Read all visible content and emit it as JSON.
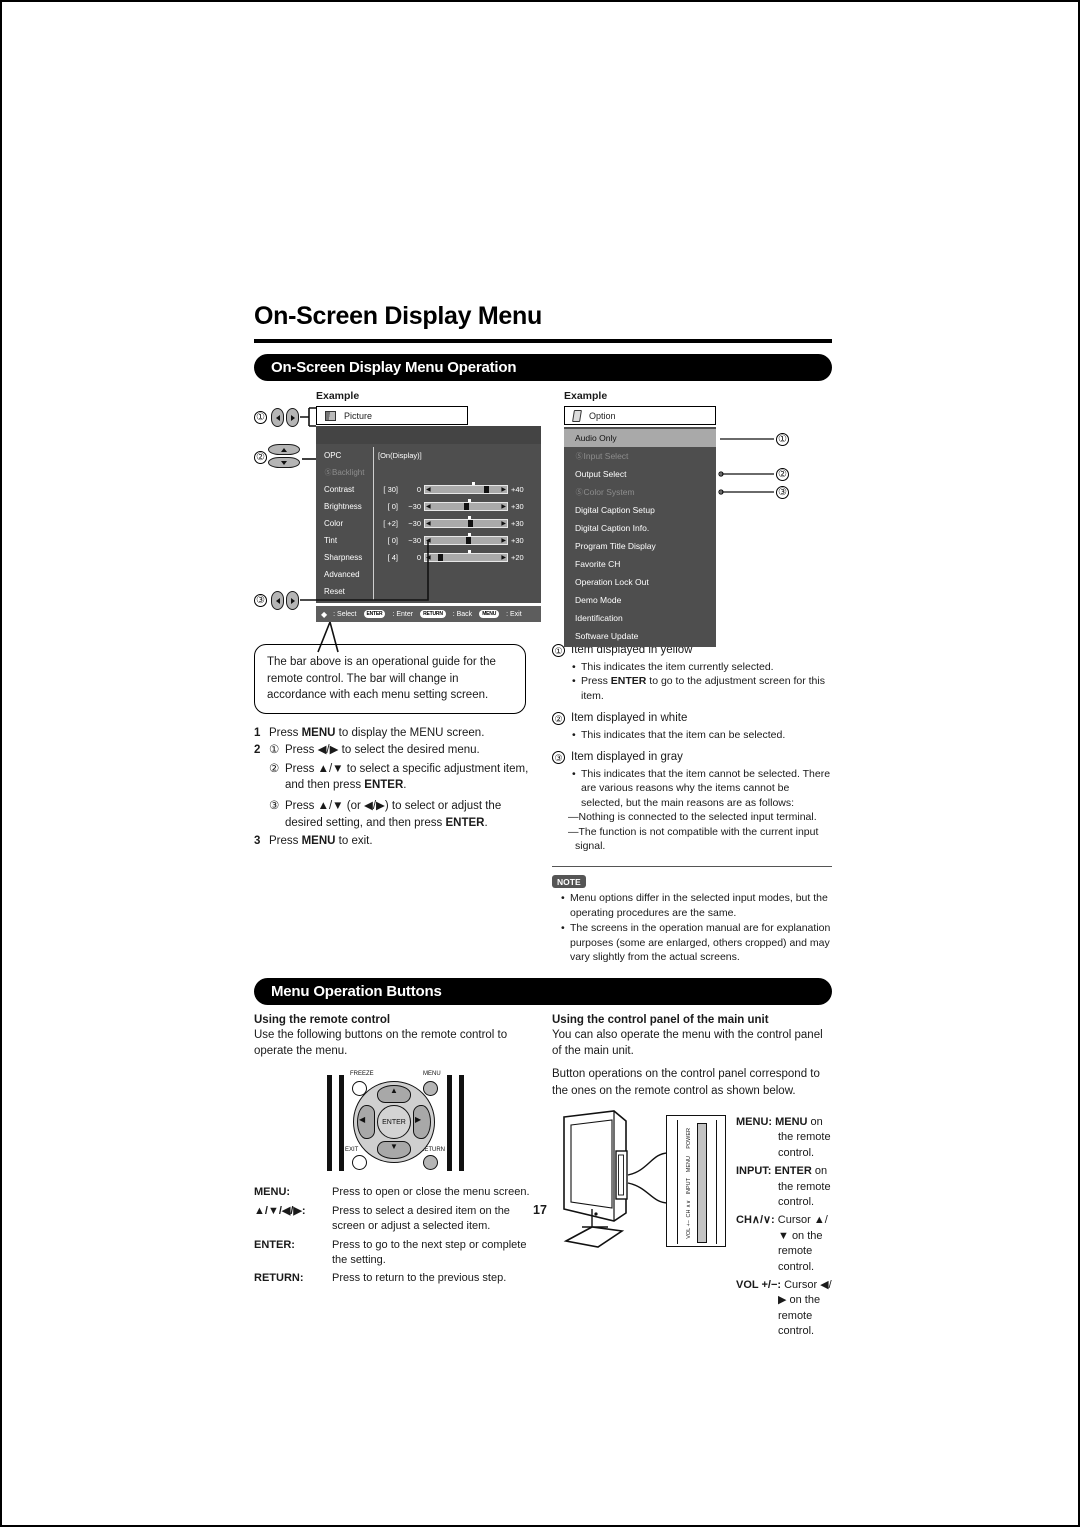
{
  "page": {
    "title": "On-Screen Display Menu",
    "number": "17"
  },
  "section1": {
    "banner": "On-Screen Display Menu Operation",
    "example_label_left": "Example",
    "example_label_right": "Example"
  },
  "picture_menu": {
    "tab_label": "Picture",
    "tab_icon": "picture-icon",
    "items": [
      {
        "label": "OPC",
        "state": "normal"
      },
      {
        "label": "Backlight",
        "state": "dim",
        "prefix": "ban-icon"
      },
      {
        "label": "Contrast",
        "state": "normal"
      },
      {
        "label": "Brightness",
        "state": "normal"
      },
      {
        "label": "Color",
        "state": "normal"
      },
      {
        "label": "Tint",
        "state": "normal"
      },
      {
        "label": "Sharpness",
        "state": "normal"
      },
      {
        "label": "Advanced",
        "state": "normal"
      },
      {
        "label": "Reset",
        "state": "normal"
      }
    ],
    "opc_value": "[On(Display)]",
    "sliders": [
      {
        "name": "Contrast",
        "value": "[ 30]",
        "min": "0",
        "max": "+40",
        "pos": 72,
        "tick": 57
      },
      {
        "name": "Brightness",
        "value": "[  0]",
        "min": "−30",
        "max": "+30",
        "pos": 48,
        "tick": 52
      },
      {
        "name": "Color",
        "value": "[ +2]",
        "min": "−30",
        "max": "+30",
        "pos": 53,
        "tick": 52
      },
      {
        "name": "Tint",
        "value": "[  0]",
        "min": "−30",
        "max": "+30",
        "pos": 50,
        "tick": 52
      },
      {
        "name": "Sharpness",
        "value": "[  4]",
        "min": "0",
        "max": "+20",
        "pos": 16,
        "tick": 52
      }
    ],
    "guide_bar": {
      "select_label": ": Select",
      "enter_key": "ENTER",
      "enter_label": ": Enter",
      "return_key": "RETURN",
      "return_label": ": Back",
      "menu_key": "MENU",
      "menu_label": ": Exit"
    }
  },
  "option_menu": {
    "tab_label": "Option",
    "tab_icon": "option-icon",
    "items": [
      {
        "label": "Audio Only",
        "state": "selected"
      },
      {
        "label": "Input Select",
        "state": "dim"
      },
      {
        "label": "Output Select",
        "state": "normal"
      },
      {
        "label": "Color System",
        "state": "dim"
      },
      {
        "label": "Digital Caption Setup",
        "state": "normal"
      },
      {
        "label": "Digital Caption Info.",
        "state": "normal"
      },
      {
        "label": "Program Title Display",
        "state": "normal"
      },
      {
        "label": "Favorite CH",
        "state": "normal"
      },
      {
        "label": "Operation Lock Out",
        "state": "normal"
      },
      {
        "label": "Demo Mode",
        "state": "normal"
      },
      {
        "label": "Identification",
        "state": "normal"
      },
      {
        "label": "Software Update",
        "state": "normal"
      }
    ]
  },
  "callout": {
    "text": "The bar above is an operational guide for the remote control. The bar will change in accordance with each menu setting screen."
  },
  "steps": {
    "s1_num": "1",
    "s1_text_a": "Press ",
    "s1_bold": "MENU",
    "s1_text_b": " to display the MENU screen.",
    "s2_num": "2",
    "s2_c1": "①",
    "s2_c1_text": "Press ◀/▶ to select the desired menu.",
    "s2_c2": "②",
    "s2_c2_text_a": "Press ▲/▼ to select a specific adjustment item, and then press ",
    "s2_c2_bold": "ENTER",
    "s2_c2_text_b": ".",
    "s2_c3": "③",
    "s2_c3_text_a": "Press ▲/▼ (or ◀/▶) to select or adjust the desired setting, and then press ",
    "s2_c3_bold": "ENTER",
    "s2_c3_text_b": ".",
    "s3_num": "3",
    "s3_text_a": "Press ",
    "s3_bold": "MENU",
    "s3_text_b": " to exit."
  },
  "explanations": [
    {
      "marker": "①",
      "heading": "Item displayed in yellow",
      "bullets": [
        "This indicates the item currently selected.",
        "Press ENTER to go to the adjustment screen for this item."
      ],
      "bold_word": "ENTER"
    },
    {
      "marker": "②",
      "heading": "Item displayed in white",
      "bullets": [
        "This indicates that the item can be selected."
      ]
    },
    {
      "marker": "③",
      "heading": "Item displayed in gray",
      "bullets": [
        "This indicates that the item cannot be selected. There are various reasons why the items cannot be selected, but the main reasons are as follows:"
      ],
      "dashes": [
        "—Nothing is connected to the selected input terminal.",
        "—The function is not compatible with the current input signal."
      ]
    }
  ],
  "note": {
    "badge": "NOTE",
    "items": [
      "Menu options differ in the selected input modes, but the operating procedures are the same.",
      "The screens in the operation manual are for explanation purposes (some are enlarged, others cropped) and may vary slightly from the actual screens."
    ]
  },
  "section2": {
    "banner": "Menu Operation Buttons",
    "left_heading": "Using the remote control",
    "left_body": "Use the following buttons on the remote control to operate the menu.",
    "right_heading": "Using the control panel of the main unit",
    "right_body_1": "You can also operate the menu with the control panel of the main unit.",
    "right_body_2": "Button operations on the control panel correspond to the ones on the remote control as shown below."
  },
  "remote": {
    "freeze": "FREEZE",
    "menu": "MENU",
    "exit": "EXIT",
    "return": "RETURN",
    "enter": "ENTER",
    "up": "▲",
    "down": "▼",
    "left": "◀",
    "right": "▶"
  },
  "remote_defs": [
    {
      "key": "MENU:",
      "value": "Press to open or close the menu screen."
    },
    {
      "key": "▲/▼/◀/▶:",
      "value": "Press to select a desired item on the screen or adjust a selected item."
    },
    {
      "key": "ENTER:",
      "value": "Press to go to the next step or complete the setting."
    },
    {
      "key": "RETURN:",
      "value": "Press to return to the previous step."
    }
  ],
  "control_panel": {
    "labels": [
      "POWER",
      "MENU",
      "INPUT",
      "CH ∧∨",
      "VOL +−"
    ],
    "defs": [
      {
        "bold": "MENU: MENU",
        "rest": " on the remote control."
      },
      {
        "bold": "INPUT: ENTER",
        "rest": " on the remote control."
      },
      {
        "bold": "CH∧/∨:",
        "rest": " Cursor ▲/▼ on the remote control."
      },
      {
        "bold": "VOL +/−:",
        "rest": " Cursor ◀/▶ on the remote control."
      }
    ]
  },
  "markers": {
    "m1": "①",
    "m2": "②",
    "m3": "③"
  },
  "colors": {
    "osd_bg": "#4e4e4e",
    "osd_selected": "#a9a9a9",
    "osd_dim_text": "#8d8d8d",
    "banner_bg": "#000000"
  }
}
